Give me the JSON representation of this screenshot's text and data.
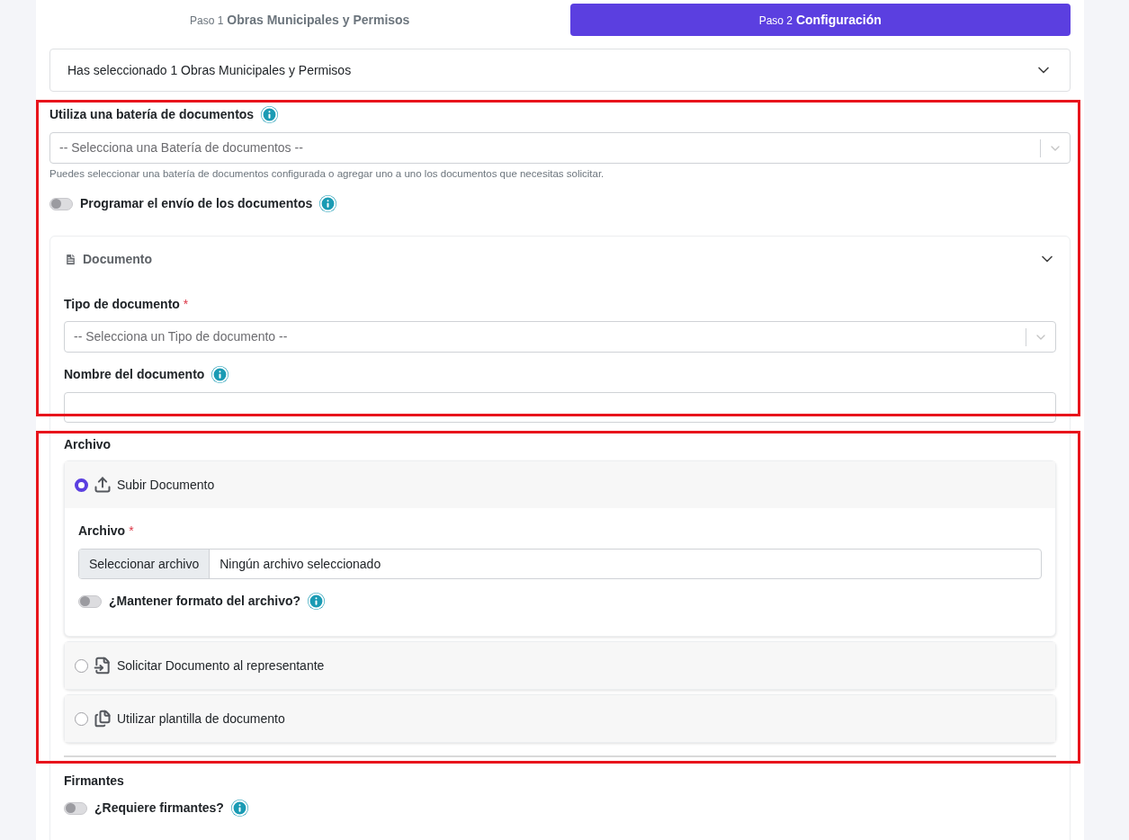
{
  "steps": [
    {
      "prefix": "Paso 1",
      "label": "Obras Municipales y Permisos",
      "selected": false
    },
    {
      "prefix": "Paso 2",
      "label": "Configuración",
      "selected": true
    }
  ],
  "summary": {
    "text": "Has seleccionado 1 Obras Municipales y Permisos",
    "expanded": false
  },
  "battery": {
    "label": "Utiliza una batería de documentos",
    "placeholder": "-- Selecciona una Batería de documentos --",
    "help": "Puedes seleccionar una batería de documentos configurada o agregar uno a uno los documentos que necesitas solicitar."
  },
  "schedule": {
    "label": "Programar el envío de los documentos",
    "on": false
  },
  "document": {
    "title": "Documento",
    "expanded": true,
    "type_field": {
      "label": "Tipo de documento",
      "required": "*",
      "placeholder": "-- Selecciona un Tipo de documento --"
    },
    "name_field": {
      "label": "Nombre del documento"
    },
    "file_section": {
      "label": "Archivo",
      "options": [
        {
          "kind": "upload",
          "label": "Subir Documento",
          "selected": true,
          "file_label": "Archivo",
          "required": "*",
          "button": "Seleccionar archivo",
          "file_status": "Ningún archivo seleccionado",
          "keep_format": {
            "label": "¿Mantener formato del archivo?",
            "on": false
          }
        },
        {
          "kind": "request",
          "label": "Solicitar Documento al representante",
          "selected": false
        },
        {
          "kind": "template",
          "label": "Utilizar plantilla de documento",
          "selected": false
        }
      ]
    },
    "signers": {
      "label": "Firmantes",
      "toggle": {
        "label": "¿Requiere firmantes?",
        "on": false
      }
    }
  },
  "highlights": [
    {
      "color": "#e8141c"
    },
    {
      "color": "#e8141c"
    }
  ]
}
